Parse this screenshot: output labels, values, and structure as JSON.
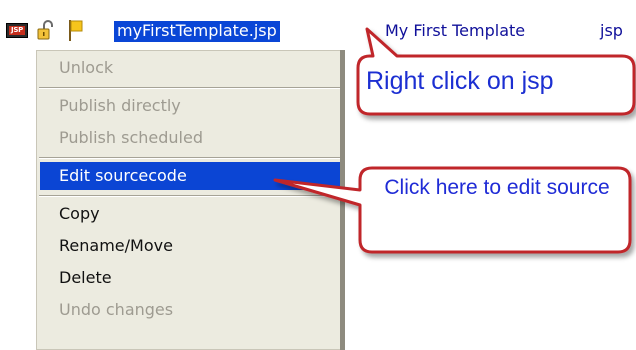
{
  "file_row": {
    "filename": "myFirstTemplate.jsp",
    "title": "My First Template",
    "type": "jsp",
    "icons": [
      "jsp-file-icon",
      "unlocked-padlock-icon",
      "yellow-flag-icon"
    ],
    "jsp_icon_label": "JSP"
  },
  "context_menu": {
    "items": [
      {
        "label": "Unlock",
        "enabled": false
      },
      {
        "label": "Publish directly",
        "enabled": false
      },
      {
        "label": "Publish scheduled",
        "enabled": false
      },
      {
        "label": "Edit sourcecode",
        "enabled": true,
        "highlighted": true
      },
      {
        "label": "Copy",
        "enabled": true
      },
      {
        "label": "Rename/Move",
        "enabled": true
      },
      {
        "label": "Delete",
        "enabled": true
      },
      {
        "label": "Undo changes",
        "enabled": false
      }
    ]
  },
  "callouts": {
    "right_click": "Right click on jsp",
    "edit_source": "Click here to edit source"
  },
  "colors": {
    "selection": "#0b45d4",
    "menu_bg": "#ecebe0",
    "callout_border": "#c0262c",
    "callout_text": "#1f2bd6",
    "disabled_text": "#9e9b91"
  }
}
